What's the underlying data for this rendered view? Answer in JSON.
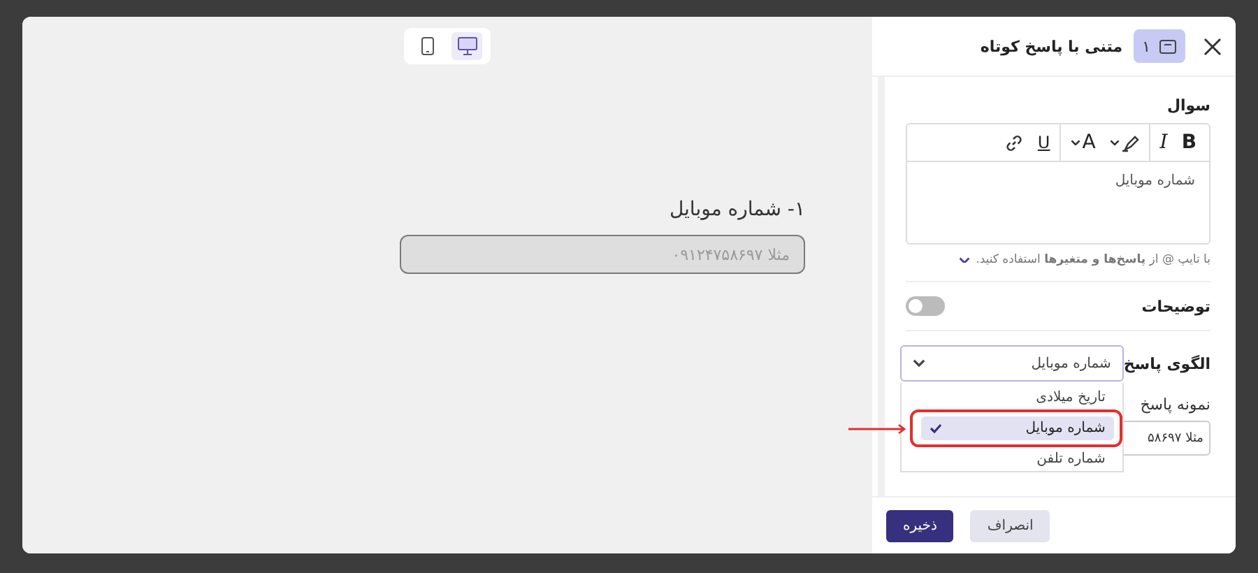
{
  "preview": {
    "devices": [
      {
        "kind": "mobile",
        "selected": false
      },
      {
        "kind": "desktop",
        "selected": true
      }
    ],
    "question": {
      "title": "۱- شماره موبایل",
      "placeholder": "مثلا ۰۹۱۲۴۷۵۸۶۹۷"
    }
  },
  "panel": {
    "title": "متنی با پاسخ کوتاه",
    "badge": "۱",
    "question_label": "سوال",
    "toolbar": [
      {
        "kind": "bold",
        "label": "B"
      },
      {
        "kind": "italic",
        "label": "I"
      },
      {
        "kind": "highlight"
      },
      {
        "kind": "font-size",
        "label": "A"
      },
      {
        "kind": "underline",
        "label": "U"
      },
      {
        "kind": "link"
      }
    ],
    "editor_text": "شماره موبایل",
    "hint": "با تایپ @ از **پاسخ‌ها و متغیرها** استفاده کنید.",
    "description": {
      "label": "توضیحات",
      "on": false
    },
    "pattern": {
      "label": "الگوی پاسخ",
      "value": "شماره موبایل",
      "expanded": true,
      "options": [
        {
          "label": "تاریخ میلادی",
          "selected": false
        },
        {
          "label": "شماره موبایل",
          "selected": true
        },
        {
          "label": "شماره تلفن",
          "selected": false
        }
      ]
    },
    "sample": {
      "label": "نمونه پاسخ",
      "value": "مثلا ۵۸۶۹۷"
    },
    "buttons": [
      {
        "kind": "secondary",
        "label": "انصراف"
      },
      {
        "kind": "primary",
        "label": "ذخیره"
      }
    ]
  }
}
